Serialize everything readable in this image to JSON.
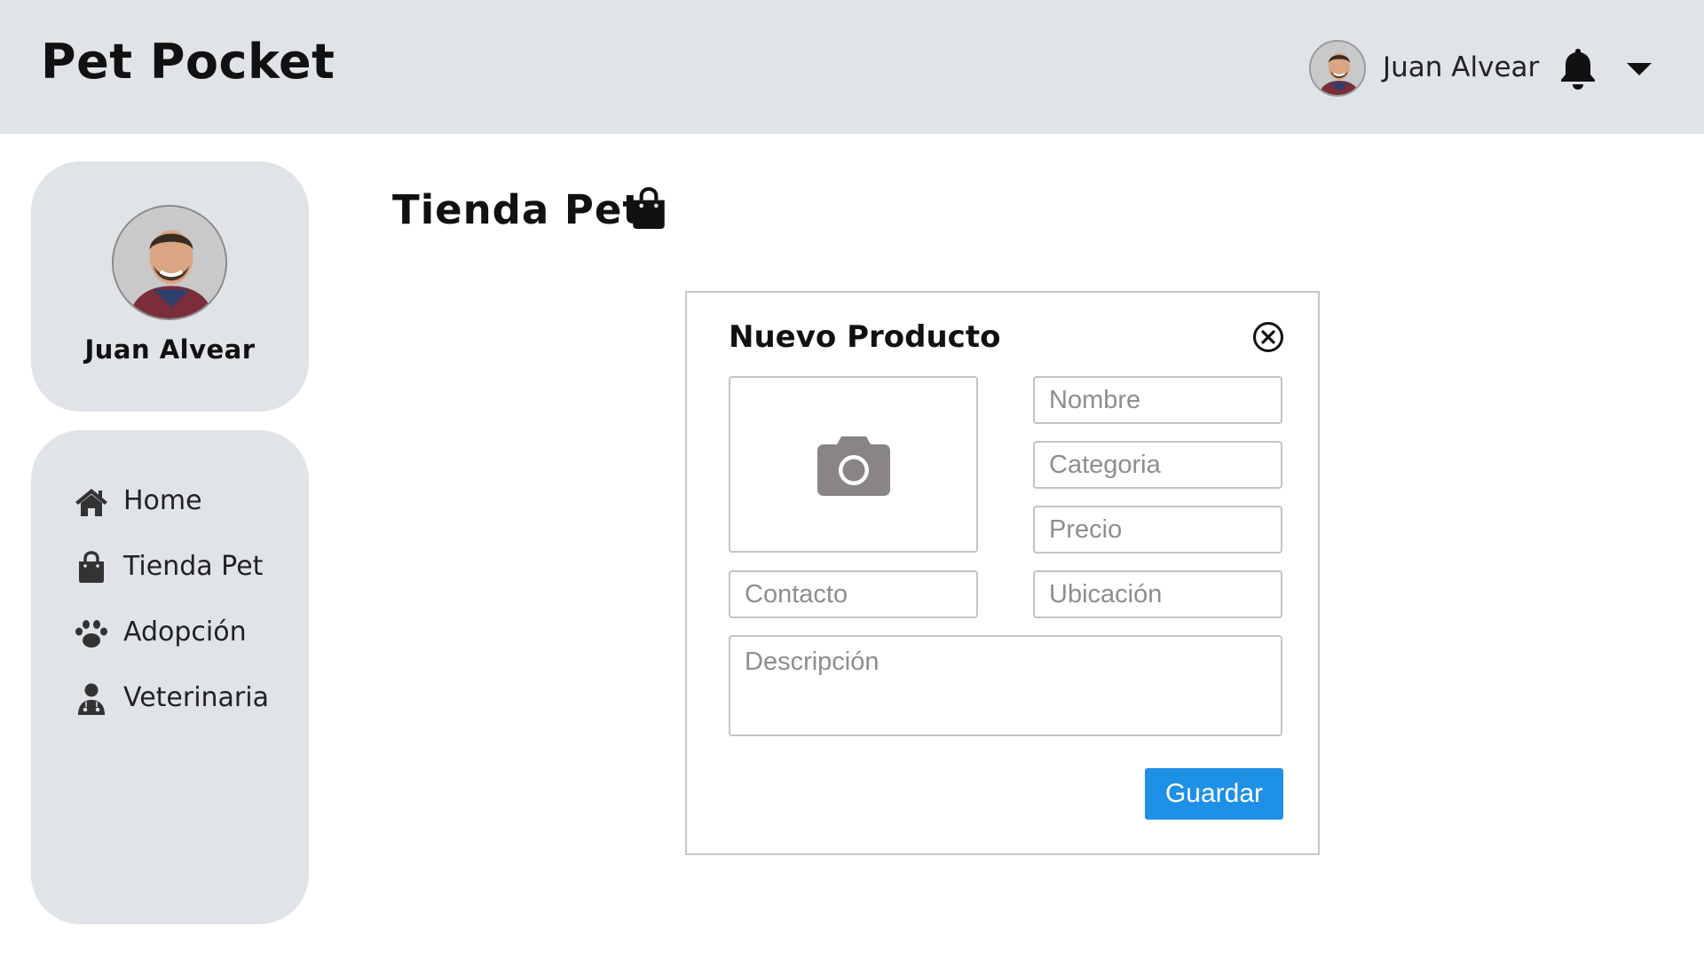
{
  "header": {
    "app_title": "Pet Pocket",
    "user_name": "Juan Alvear",
    "icons": [
      "bell-icon",
      "caret-down-icon"
    ]
  },
  "profile": {
    "name": "Juan Alvear"
  },
  "sidebar": {
    "items": [
      {
        "label": "Home",
        "icon": "home-icon"
      },
      {
        "label": "Tienda Pet",
        "icon": "shopping-bag-icon"
      },
      {
        "label": "Adopción",
        "icon": "paw-icon"
      },
      {
        "label": "Veterinaria",
        "icon": "doctor-icon"
      }
    ]
  },
  "page": {
    "title": "Tienda Pet",
    "title_icon": "shopping-bag-icon"
  },
  "modal": {
    "title": "Nuevo Producto",
    "fields": {
      "nombre": {
        "placeholder": "Nombre",
        "value": ""
      },
      "categoria": {
        "placeholder": "Categoria",
        "value": ""
      },
      "precio": {
        "placeholder": "Precio",
        "value": ""
      },
      "contacto": {
        "placeholder": "Contacto",
        "value": ""
      },
      "ubicacion": {
        "placeholder": "Ubicación",
        "value": ""
      },
      "descripcion": {
        "placeholder": "Descripción",
        "value": ""
      }
    },
    "save_label": "Guardar",
    "icons": [
      "close-circle-icon",
      "camera-icon"
    ]
  },
  "colors": {
    "header_bg": "#e0e3e7",
    "card_bg": "#e0e3e7",
    "primary_button": "#1e90e6",
    "icon_gray": "#8a8585"
  }
}
